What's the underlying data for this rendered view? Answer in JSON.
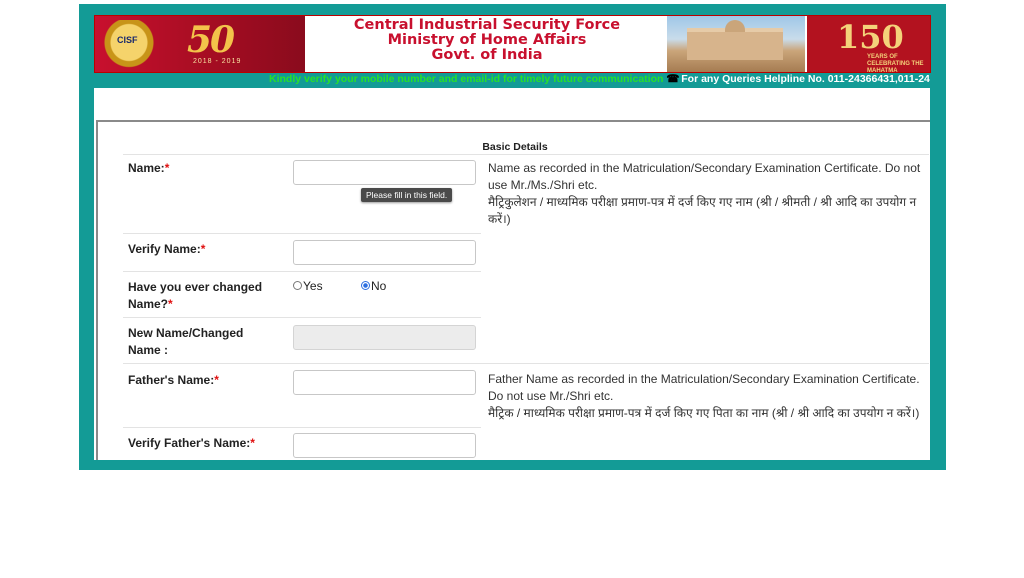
{
  "banner": {
    "emblem_text": "CISF",
    "fifty_text": "50",
    "fifty_sub": "2018 - 2019",
    "title_lines": [
      "Central Industrial Security Force",
      "Ministry of Home Affairs",
      "Govt. of India"
    ],
    "n150_text": "150",
    "n150_sub": "YEARS OF CELEBRATING THE MAHATMA"
  },
  "ticker": {
    "message": "Kindly verify your mobile number and email-id for timely future communication",
    "helpline": "For any Queries Helpline No. 011-24366431,011-24"
  },
  "form": {
    "section_title": "Basic Details",
    "tooltip": "Please fill in this field.",
    "fields": {
      "name": {
        "label": "Name:",
        "required": "*"
      },
      "verify_name": {
        "label": "Verify Name:",
        "required": "*"
      },
      "changed_name": {
        "label": "Have you ever changed Name?",
        "required": "*",
        "options": [
          "Yes",
          "No"
        ],
        "selected": "No"
      },
      "new_name": {
        "label": "New Name/Changed Name :"
      },
      "father_name": {
        "label": "Father's Name:",
        "required": "*"
      },
      "verify_father_name": {
        "label": "Verify Father's Name:",
        "required": "*"
      }
    },
    "help": {
      "name_en": "Name as recorded in the Matriculation/Secondary Examination Certificate. Do not use Mr./Ms./Shri etc.",
      "name_hi": "मैट्रिकुलेशन / माध्यमिक परीक्षा प्रमाण-पत्र में दर्ज किए गए नाम (श्री / श्रीमती / श्री आदि का उपयोग न करें।)",
      "father_en": "Father Name as recorded in the Matriculation/Secondary Examination Certificate. Do not use Mr./Shri etc.",
      "father_hi": "मैट्रिक / माध्यमिक परीक्षा प्रमाण-पत्र में दर्ज किए गए पिता का नाम (श्री / श्री आदि का उपयोग न करें।)"
    }
  },
  "colors": {
    "frame": "#139b96",
    "brand_red": "#c8102e",
    "required": "#e01010",
    "ticker_green": "#28e028"
  }
}
